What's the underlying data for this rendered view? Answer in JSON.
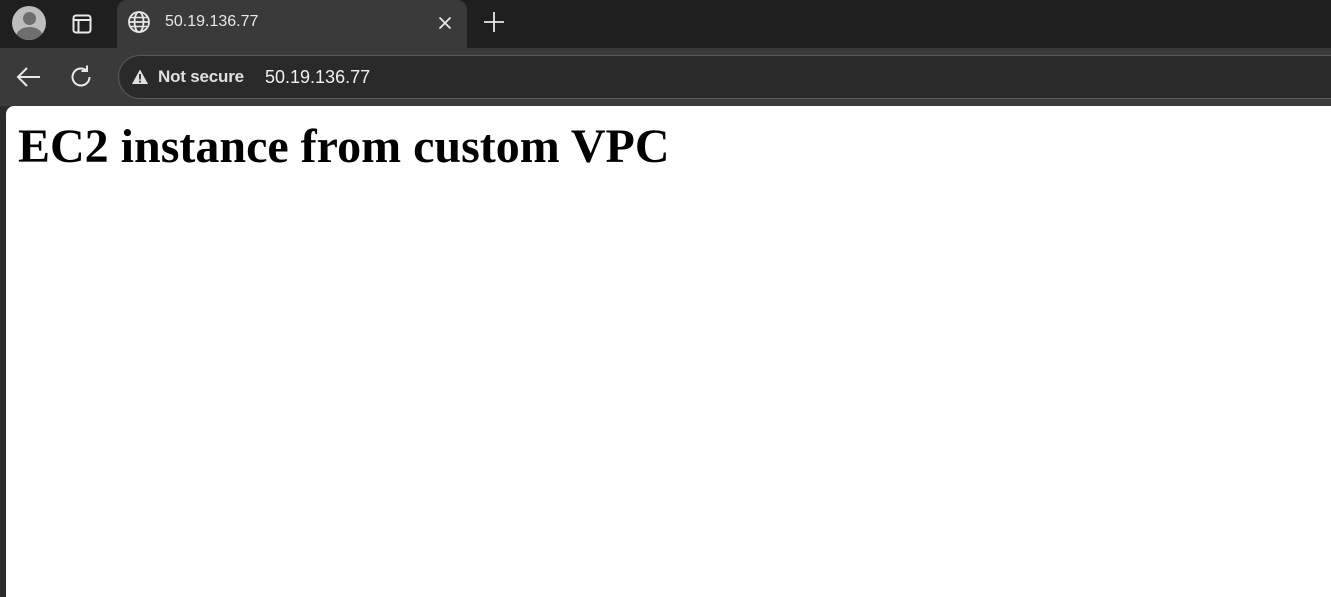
{
  "tab": {
    "title": "50.19.136.77"
  },
  "omnibox": {
    "security_label": "Not secure",
    "url": "50.19.136.77"
  },
  "page": {
    "heading": "EC2 instance from custom VPC"
  },
  "icons": {
    "profile": "profile-avatar-icon",
    "tab_actions": "tab-actions-icon",
    "site": "globe-icon",
    "close": "close-icon",
    "new_tab": "plus-icon",
    "back": "back-arrow-icon",
    "reload": "reload-icon",
    "warning": "warning-icon"
  },
  "colors": {
    "tabstrip": "#1f1f1f",
    "active_tab": "#3a3a3a",
    "toolbar": "#3a3a3a",
    "omnibox": "#2a2a2a",
    "page_background": "#ffffff"
  }
}
